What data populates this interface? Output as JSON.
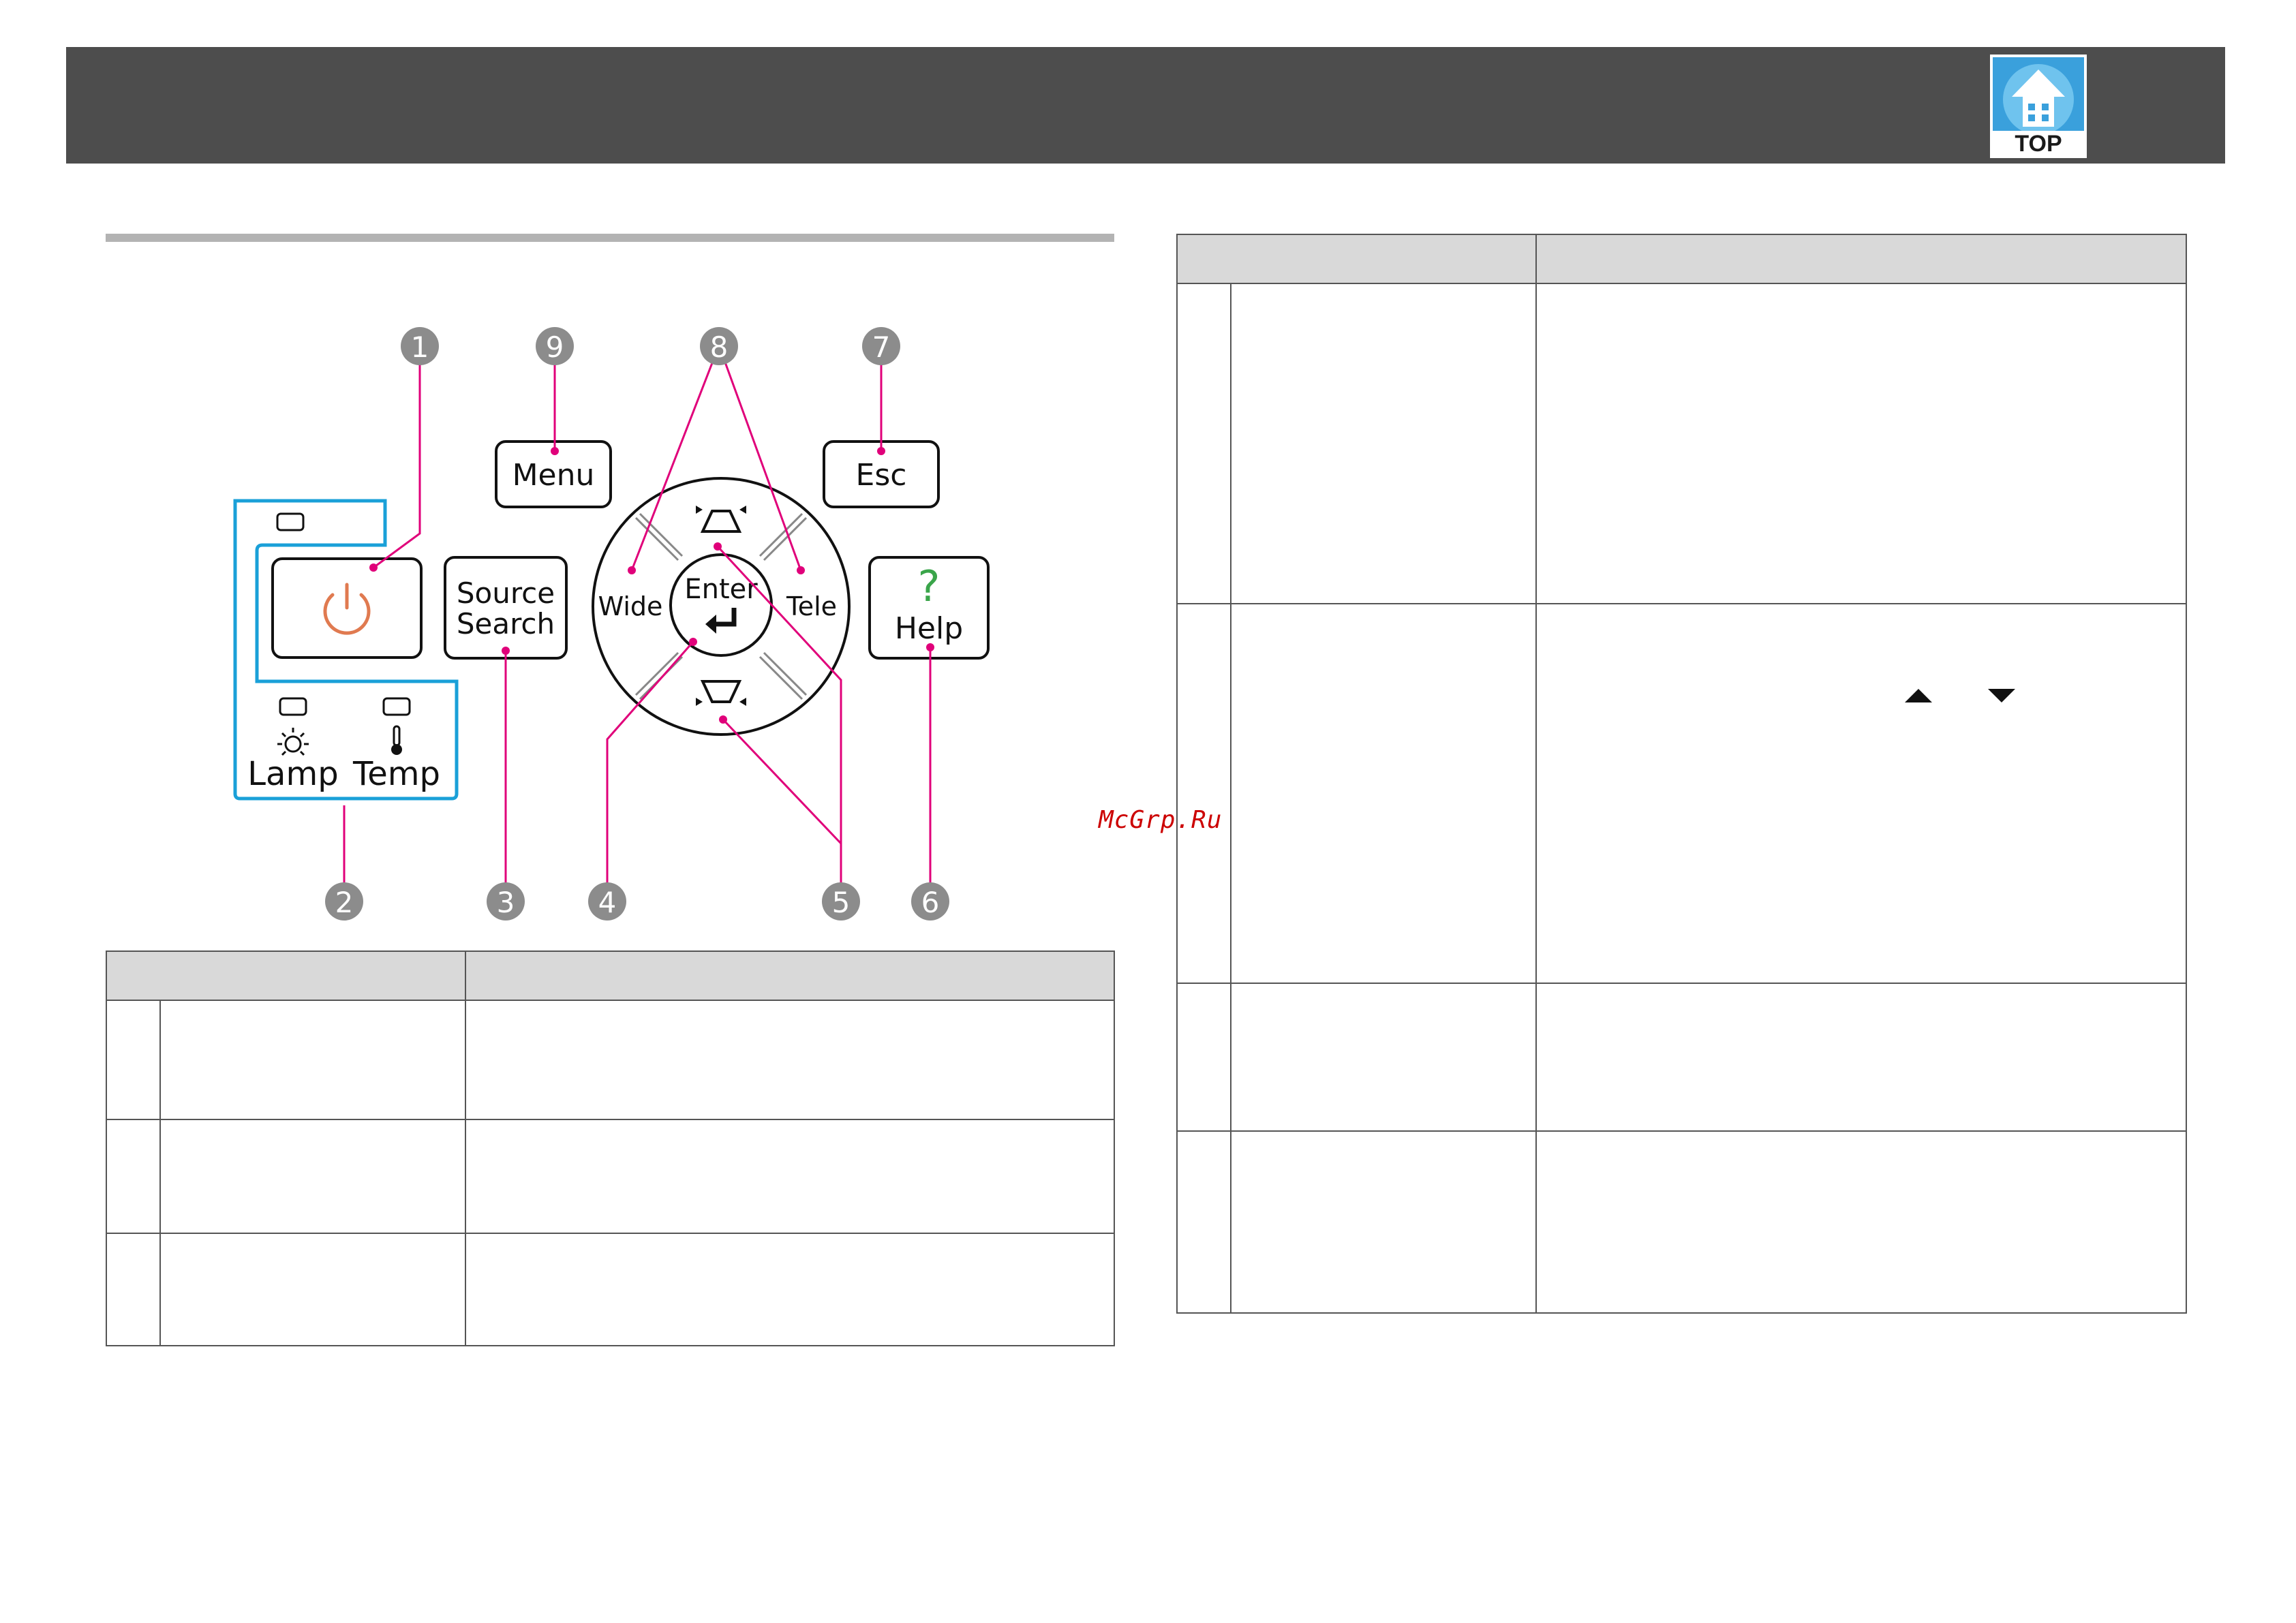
{
  "header": {
    "logo_text": "TOP"
  },
  "panel": {
    "buttons": {
      "menu": "Menu",
      "esc": "Esc",
      "source_line1": "Source",
      "source_line2": "Search",
      "help": "Help",
      "help_glyph": "?",
      "enter": "Enter",
      "wide": "Wide",
      "tele": "Tele"
    },
    "indicators": {
      "lamp": "Lamp",
      "temp": "Temp"
    },
    "callouts": [
      "1",
      "2",
      "3",
      "4",
      "5",
      "6",
      "7",
      "8",
      "9"
    ],
    "colors": {
      "callout_line": "#e0007a",
      "indicator_frame": "#1aa0d8",
      "power": "#e07a50",
      "help": "#3aa54a"
    }
  },
  "watermark": "McGrp.Ru"
}
